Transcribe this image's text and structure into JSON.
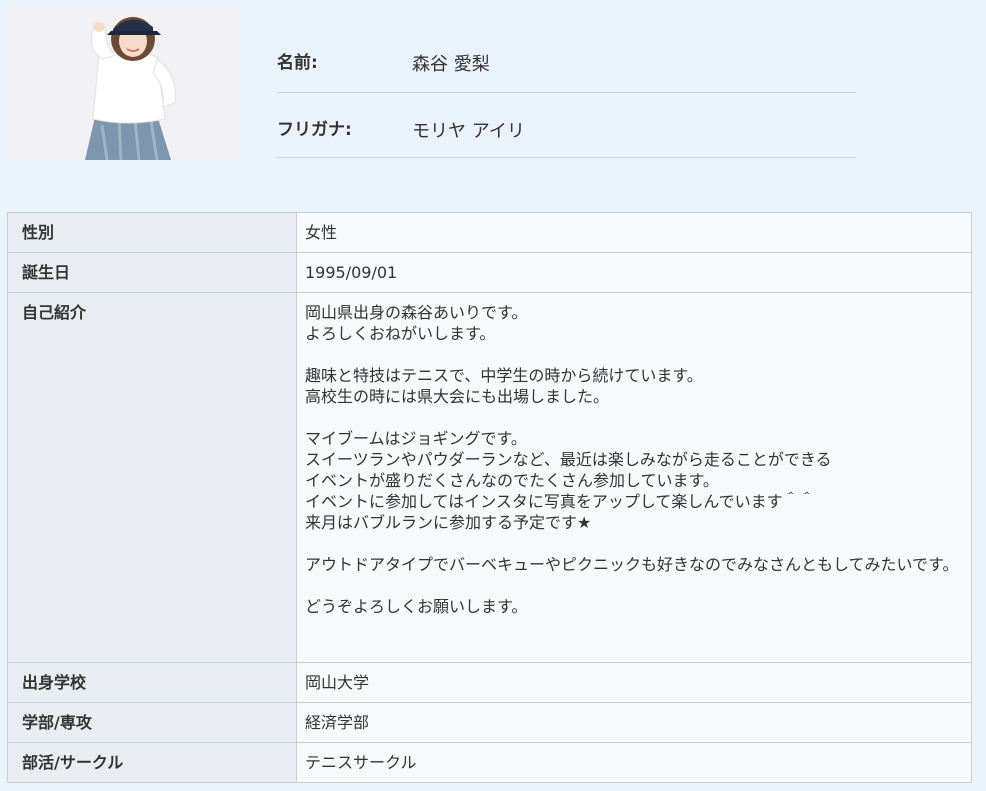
{
  "profile": {
    "name_label": "名前:",
    "name_value": "森谷 愛梨",
    "furigana_label": "フリガナ:",
    "furigana_value": "モリヤ アイリ"
  },
  "details": {
    "gender_label": "性別",
    "gender_value": "女性",
    "birthday_label": "誕生日",
    "birthday_value": "1995/09/01",
    "intro_label": "自己紹介",
    "intro_lines": [
      "岡山県出身の森谷あいりです。",
      "よろしくおねがいします。",
      "",
      "趣味と特技はテニスで、中学生の時から続けています。",
      "高校生の時には県大会にも出場しました。",
      "",
      "マイブームはジョギングです。",
      "スイーツランやパウダーランなど、最近は楽しみながら走ることができる",
      "イベントが盛りだくさんなのでたくさん参加しています。",
      "イベントに参加してはインスタに写真をアップして楽しんでいます＾＾",
      "来月はバブルランに参加する予定です★",
      "",
      "アウトドアタイプでバーベキューやピクニックも好きなのでみなさんともしてみたいです。",
      "",
      "どうぞよろしくお願いします。"
    ],
    "school_label": "出身学校",
    "school_value": "岡山大学",
    "faculty_label": "学部/専攻",
    "faculty_value": "経済学部",
    "club_label": "部活/サークル",
    "club_value": "テニスサークル"
  },
  "colors": {
    "page_background": "#eaf2fb",
    "header_cell": "#e9edf1",
    "value_cell": "#f7f9fb",
    "border": "#c8ced5",
    "text": "#333333"
  }
}
